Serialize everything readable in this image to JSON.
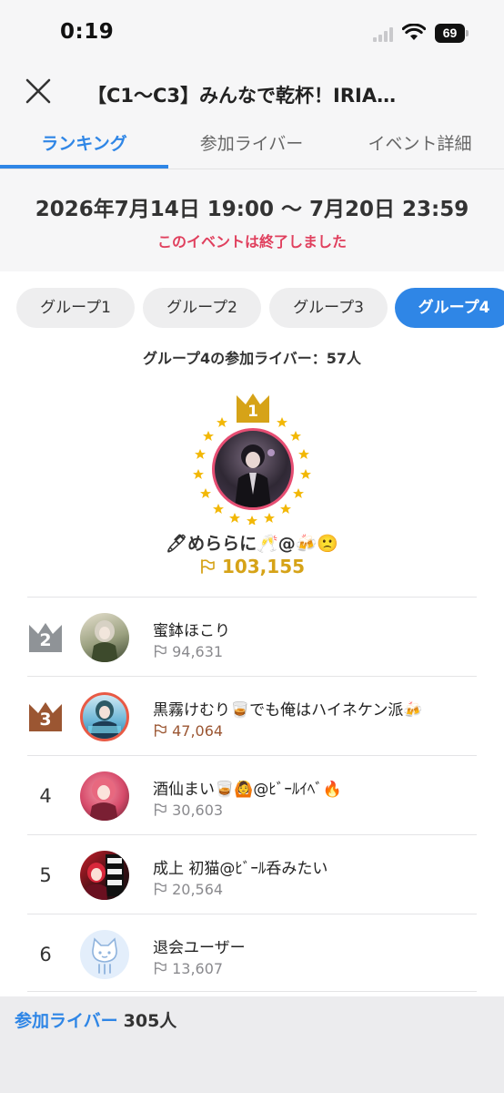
{
  "status": {
    "time": "0:19",
    "battery": "69"
  },
  "header": {
    "title": "【C1〜C3】みんなで乾杯！IRIA…"
  },
  "tabs": [
    {
      "label": "ランキング"
    },
    {
      "label": "参加ライバー"
    },
    {
      "label": "イベント詳細"
    }
  ],
  "period": {
    "date": "2026年7月14日 19:00 〜 7月20日 23:59",
    "status": "このイベントは終了しました"
  },
  "groups": [
    {
      "label": "グループ1"
    },
    {
      "label": "グループ2"
    },
    {
      "label": "グループ3"
    },
    {
      "label": "グループ4"
    }
  ],
  "group_count": "グループ4の参加ライバー：57人",
  "first": {
    "rank": "1",
    "name": "🖊めららに🥂@🍻🙁",
    "score": "103,155"
  },
  "ranking": [
    {
      "rank": "2",
      "name": "蜜鉢ほこり",
      "score": "94,631"
    },
    {
      "rank": "3",
      "name": "黒霧けむり🥃でも俺はハイネケン派🍻",
      "score": "47,064"
    },
    {
      "rank": "4",
      "name": "酒仙まい🥃🙆@ﾋﾞｰﾙｲﾍﾞ🔥",
      "score": "30,603"
    },
    {
      "rank": "5",
      "name": "成上 初猫@ﾋﾞｰﾙ呑みたい",
      "score": "20,564"
    },
    {
      "rank": "6",
      "name": "退会ユーザー",
      "score": "13,607"
    }
  ],
  "footer": {
    "link": "参加ライバー",
    "count": "305人"
  },
  "colors": {
    "accent": "#2f86e6",
    "gold": "#d6a318",
    "silver": "#8f9397",
    "bronze": "#9b5632",
    "alert": "#e0405e"
  }
}
